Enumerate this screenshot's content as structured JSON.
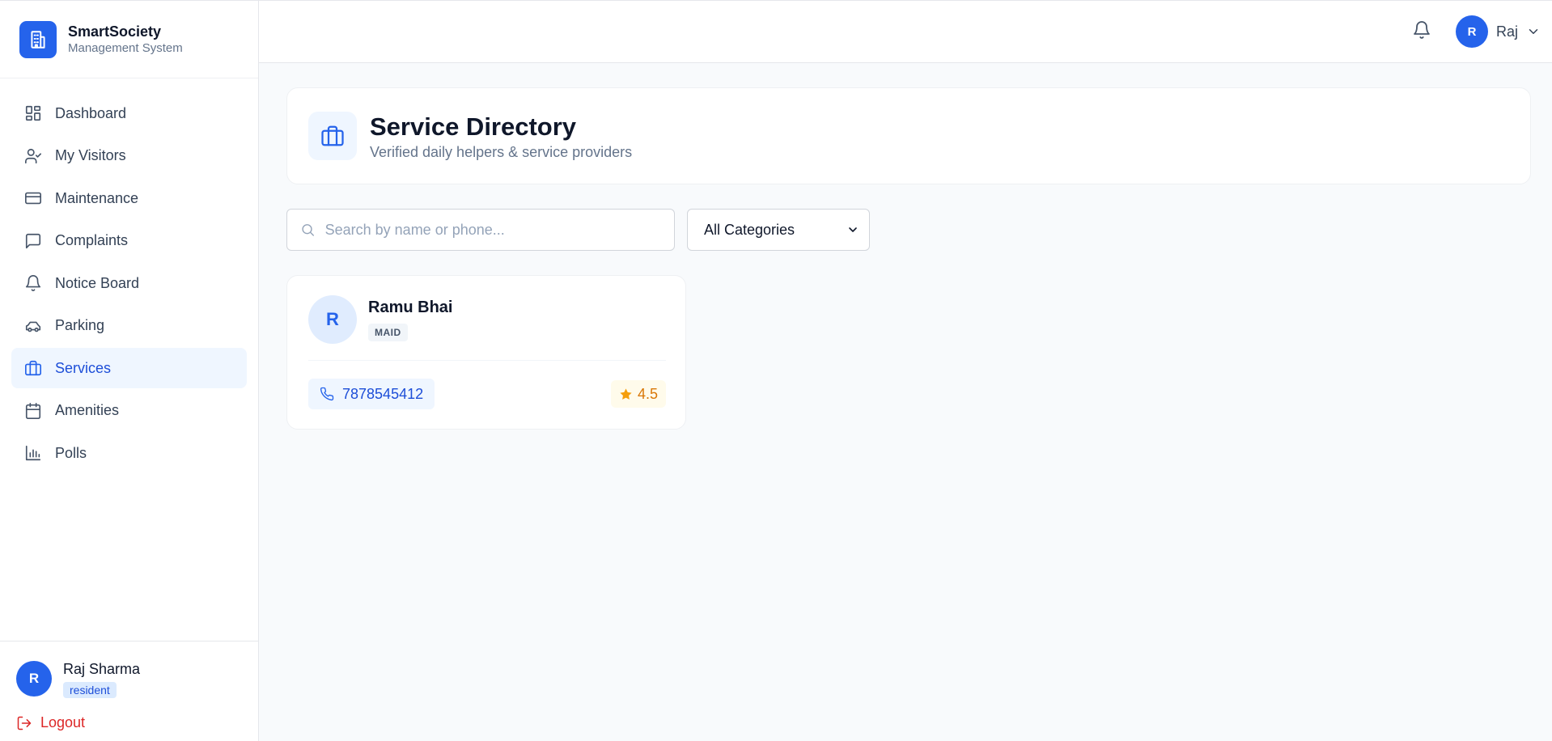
{
  "brand": {
    "name": "SmartSociety",
    "tagline": "Management System"
  },
  "sidebar": {
    "items": [
      {
        "label": "Dashboard",
        "icon": "grid-icon"
      },
      {
        "label": "My Visitors",
        "icon": "user-check-icon"
      },
      {
        "label": "Maintenance",
        "icon": "credit-card-icon"
      },
      {
        "label": "Complaints",
        "icon": "message-square-icon"
      },
      {
        "label": "Notice Board",
        "icon": "bell-icon"
      },
      {
        "label": "Parking",
        "icon": "car-icon"
      },
      {
        "label": "Services",
        "icon": "briefcase-icon",
        "active": true
      },
      {
        "label": "Amenities",
        "icon": "calendar-icon"
      },
      {
        "label": "Polls",
        "icon": "bar-chart-icon"
      }
    ],
    "user": {
      "initial": "R",
      "name": "Raj Sharma",
      "role": "resident"
    },
    "logout_label": "Logout"
  },
  "topbar": {
    "user_initial": "R",
    "user_name": "Raj"
  },
  "page": {
    "title": "Service Directory",
    "subtitle": "Verified daily helpers & service providers"
  },
  "filters": {
    "search_placeholder": "Search by name or phone...",
    "category_selected": "All Categories"
  },
  "services": [
    {
      "initial": "R",
      "name": "Ramu Bhai",
      "category": "MAID",
      "phone": "7878545412",
      "rating": "4.5"
    }
  ],
  "colors": {
    "accent": "#2563eb",
    "active_bg": "#eff6ff",
    "danger": "#dc2626",
    "rating": "#f59e0b"
  }
}
